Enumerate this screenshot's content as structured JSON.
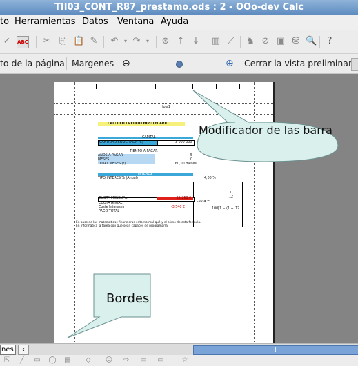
{
  "window": {
    "title": "TII03_CONT_R87_prestamo.ods : 2 - OOo-dev Calc"
  },
  "menubar": {
    "items": [
      "to",
      "Herramientas",
      "Datos",
      "Ventana",
      "Ayuda"
    ]
  },
  "preview_toolbar": {
    "page_format_label": "to de la página",
    "margins_label": "Margenes",
    "zoom_out": "⊖",
    "zoom_in": "⊕",
    "close_preview_label": "Cerrar la vista preliminar"
  },
  "sheet": {
    "header_text": "Hoja1",
    "title": "CALCULO CREDITO HIPOTECARIO",
    "capital_header": "CAPITAL",
    "capital_label": "CANTIDAD SOLICITADA (C)",
    "capital_value": "3 000 000",
    "time_header": "TIEMPO A PAGAR",
    "years_label": "AÑOS A PAGAR",
    "years_value": "5",
    "months_label": "MESES",
    "months_value": "0",
    "total_months_label": "TOTAL MESES (t)",
    "total_months_value": "60,00 meses",
    "interest_header": "INTERES",
    "interest_label": "TIPO INTERES % (Anual)",
    "interest_value": "4,00 %",
    "formula_lhs": "cuota =",
    "formula_num": "i",
    "formula_den": "12",
    "formula_bottom": "100[1 − (1 +",
    "formula_exp": "12",
    "quota_label": "CUOTA MENSUAL",
    "quota_value": "-55 250 €",
    "quota_a": "CUOTA ANUAL",
    "quota_b": "Coste Intereses",
    "quota_b_value": "-3 540 €",
    "quota_c": "PAGO TOTAL",
    "note_line1": "En base de las matemáticas financieras entorno mal qué y el cómo de esta formula.",
    "note_line2": "En informática la tarea con que sean capaces de programarla."
  },
  "callouts": {
    "top": "Modificador de las barra",
    "bottom": "Bordes"
  },
  "sheet_tabs": {
    "current": "nes"
  },
  "colors": {
    "title_band": "#f5f17a",
    "capital_band": "#3aa8d8",
    "time_band": "#b7d8f2",
    "quota_band": "#e0201a"
  }
}
